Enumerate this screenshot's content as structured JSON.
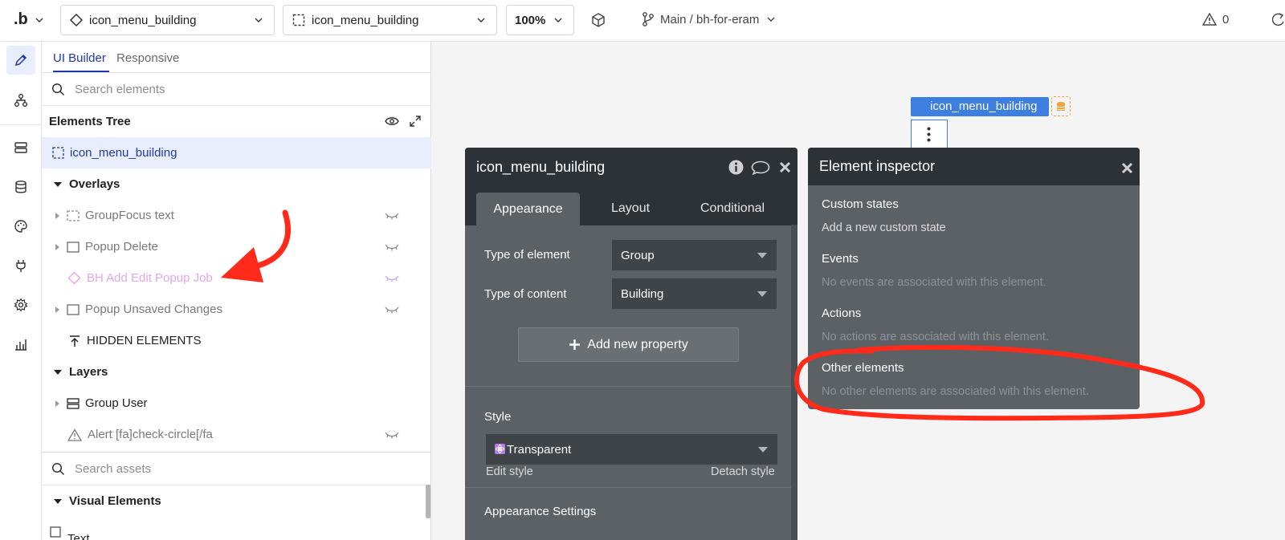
{
  "topbar": {
    "logo": ".b",
    "page_select": "icon_menu_building",
    "element_select": "icon_menu_building",
    "zoom": "100%",
    "branch": "Main / bh-for-eram",
    "issues_count": "0"
  },
  "panel": {
    "tabs": {
      "ui_builder": "UI Builder",
      "responsive": "Responsive"
    },
    "search_placeholder": "Search elements",
    "tree_title": "Elements Tree",
    "selected_element": "icon_menu_building",
    "items": [
      {
        "label": "Overlays"
      },
      {
        "label": "GroupFocus text"
      },
      {
        "label": "Popup Delete"
      },
      {
        "label": "BH Add Edit Popup Job"
      },
      {
        "label": "Popup Unsaved Changes"
      },
      {
        "label": "HIDDEN ELEMENTS"
      },
      {
        "label": "Layers"
      },
      {
        "label": "Group User"
      },
      {
        "label": "Alert [fa]check-circle[/fa"
      }
    ],
    "assets_placeholder": "Search assets",
    "visual_elements": "Visual Elements",
    "next_item": "Text"
  },
  "canvas": {
    "element_label": "icon_menu_building"
  },
  "property_editor": {
    "title": "icon_menu_building",
    "tabs": {
      "appearance": "Appearance",
      "layout": "Layout",
      "conditional": "Conditional"
    },
    "type_of_element_label": "Type of element",
    "type_of_element_value": "Group",
    "type_of_content_label": "Type of content",
    "type_of_content_value": "Building",
    "add_property": "Add new property",
    "style_label": "Style",
    "style_value": "Transparent",
    "edit_style": "Edit style",
    "detach_style": "Detach style",
    "appearance_settings": "Appearance Settings"
  },
  "inspector": {
    "title": "Element inspector",
    "custom_states": "Custom states",
    "add_state": "Add a new custom state",
    "events": "Events",
    "events_empty": "No events are associated with this element.",
    "actions": "Actions",
    "actions_empty": "No actions are associated with this element.",
    "other": "Other elements",
    "other_empty": "No other elements are associated with this element."
  },
  "colors": {
    "accent": "#1f3aa8",
    "canvas_label_blue": "#3d7fe0",
    "annotation_red": "#ff2a1a",
    "dark_header": "#2d3236",
    "dark_panel": "#5c6166"
  }
}
